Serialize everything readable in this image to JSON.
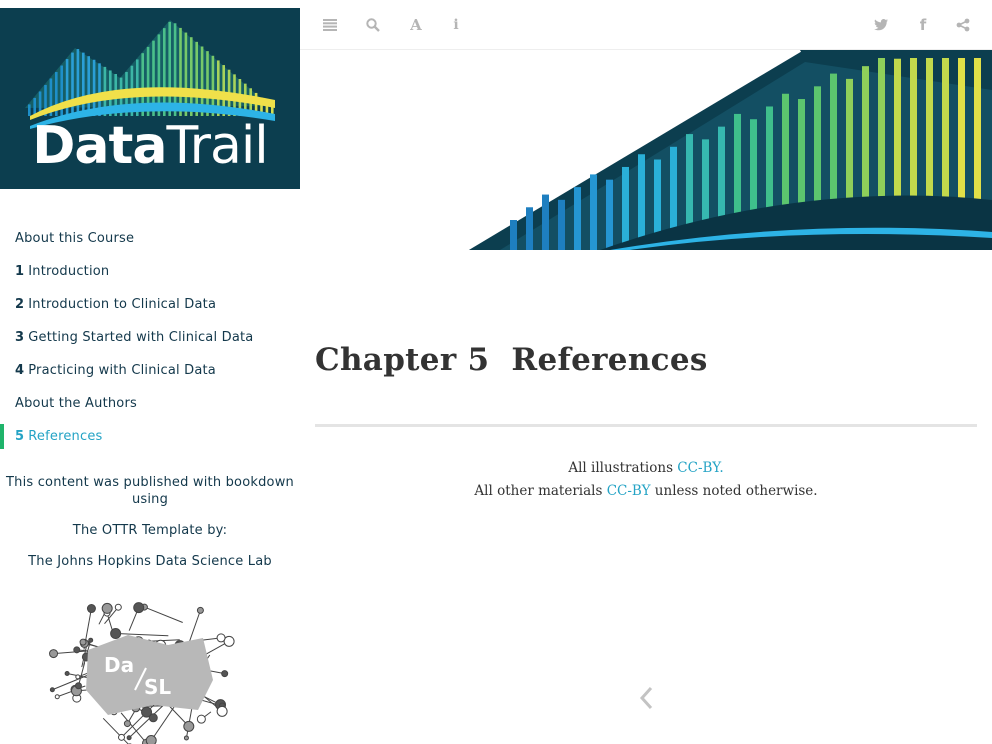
{
  "logo": {
    "text_bold": "Data",
    "text_light": "Trail"
  },
  "toolbar": {
    "left": [
      {
        "icon": "menu-icon"
      },
      {
        "icon": "search-icon"
      },
      {
        "icon": "font-settings-icon",
        "glyph": "A"
      },
      {
        "icon": "info-icon",
        "glyph": "i"
      }
    ],
    "right": [
      {
        "icon": "twitter-icon"
      },
      {
        "icon": "facebook-icon",
        "glyph": "f"
      },
      {
        "icon": "share-icon"
      }
    ]
  },
  "toc": [
    {
      "num": "",
      "label": "About this Course",
      "active": false
    },
    {
      "num": "1",
      "label": "Introduction",
      "active": false
    },
    {
      "num": "2",
      "label": "Introduction to Clinical Data",
      "active": false
    },
    {
      "num": "3",
      "label": "Getting Started with Clinical Data",
      "active": false
    },
    {
      "num": "4",
      "label": "Practicing with Clinical Data",
      "active": false
    },
    {
      "num": "",
      "label": "About the Authors",
      "active": false
    },
    {
      "num": "5",
      "label": "References",
      "active": true
    }
  ],
  "credits": {
    "published": "This content was published with bookdown using",
    "template": "The OTTR Template by:",
    "lab": "The Johns Hopkins Data Science Lab"
  },
  "dasl_logo_text": {
    "d": "Da",
    "s": "SL"
  },
  "chapter": {
    "number": "Chapter 5",
    "title": "References"
  },
  "footer": {
    "line1_prefix": "All illustrations ",
    "line1_link": "CC-BY.",
    "line2_prefix": "All other materials ",
    "line2_link": "CC-BY",
    "line2_suffix": " unless noted otherwise."
  },
  "colors": {
    "accent": "#24a3c5",
    "active_bar": "#1fb46b",
    "logo_bg": "#0c3e4f",
    "text": "#13384b"
  }
}
